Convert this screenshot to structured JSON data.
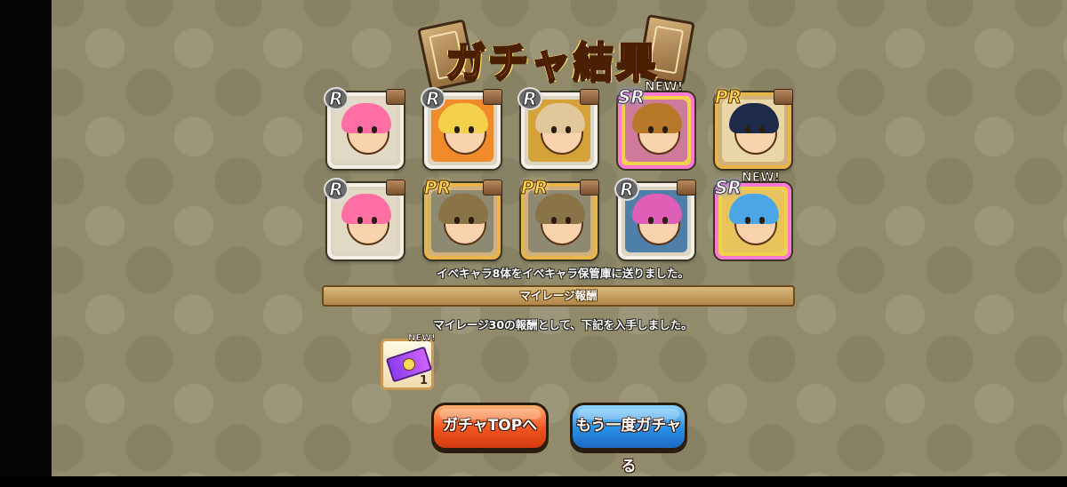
{
  "title": "ガチャ結果",
  "characters": [
    {
      "rarity": "R",
      "new": "",
      "frame": "r",
      "hair": "#ff6fa3",
      "bg": "#e3d9c7"
    },
    {
      "rarity": "R",
      "new": "",
      "frame": "r",
      "hair": "#f3d14a",
      "bg": "#f08a2a"
    },
    {
      "rarity": "R",
      "new": "",
      "frame": "r",
      "hair": "#e2c79b",
      "bg": "#d5a23a"
    },
    {
      "rarity": "SR",
      "new": "NEW!",
      "frame": "sr",
      "hair": "#b8782a",
      "bg": "#cf7a9a"
    },
    {
      "rarity": "PR",
      "new": "",
      "frame": "pr",
      "hair": "#1e2a4a",
      "bg": "#e8d6a6"
    },
    {
      "rarity": "R",
      "new": "",
      "frame": "r",
      "hair": "#ff6fa3",
      "bg": "#e3d9c7"
    },
    {
      "rarity": "PR",
      "new": "",
      "frame": "pr",
      "hair": "#8a7346",
      "bg": "#8e8a72"
    },
    {
      "rarity": "PR",
      "new": "",
      "frame": "pr",
      "hair": "#8a7346",
      "bg": "#8e8a72"
    },
    {
      "rarity": "R",
      "new": "",
      "frame": "r",
      "hair": "#e05fb6",
      "bg": "#4d7fa8"
    },
    {
      "rarity": "SR",
      "new": "NEW!",
      "frame": "sr",
      "hair": "#4aa6e6",
      "bg": "#e8c25a"
    }
  ],
  "sent_message": "イベキャラ8体をイベキャラ保管庫に送りました。",
  "mileage_banner": "マイレージ報酬",
  "mileage_message": "マイレージ30の報酬として、下記を入手しました。",
  "reward": {
    "new": "NEW!",
    "count": "1",
    "icon": "ticket-icon"
  },
  "buttons": {
    "gacha_top": "ガチャTOPへ",
    "gacha_again": "もう一度ガチャる"
  },
  "colors": {
    "background": "#918a6b",
    "orange_button": "#f2541e",
    "blue_button": "#2a8ee6",
    "title": "#ff8a00"
  }
}
